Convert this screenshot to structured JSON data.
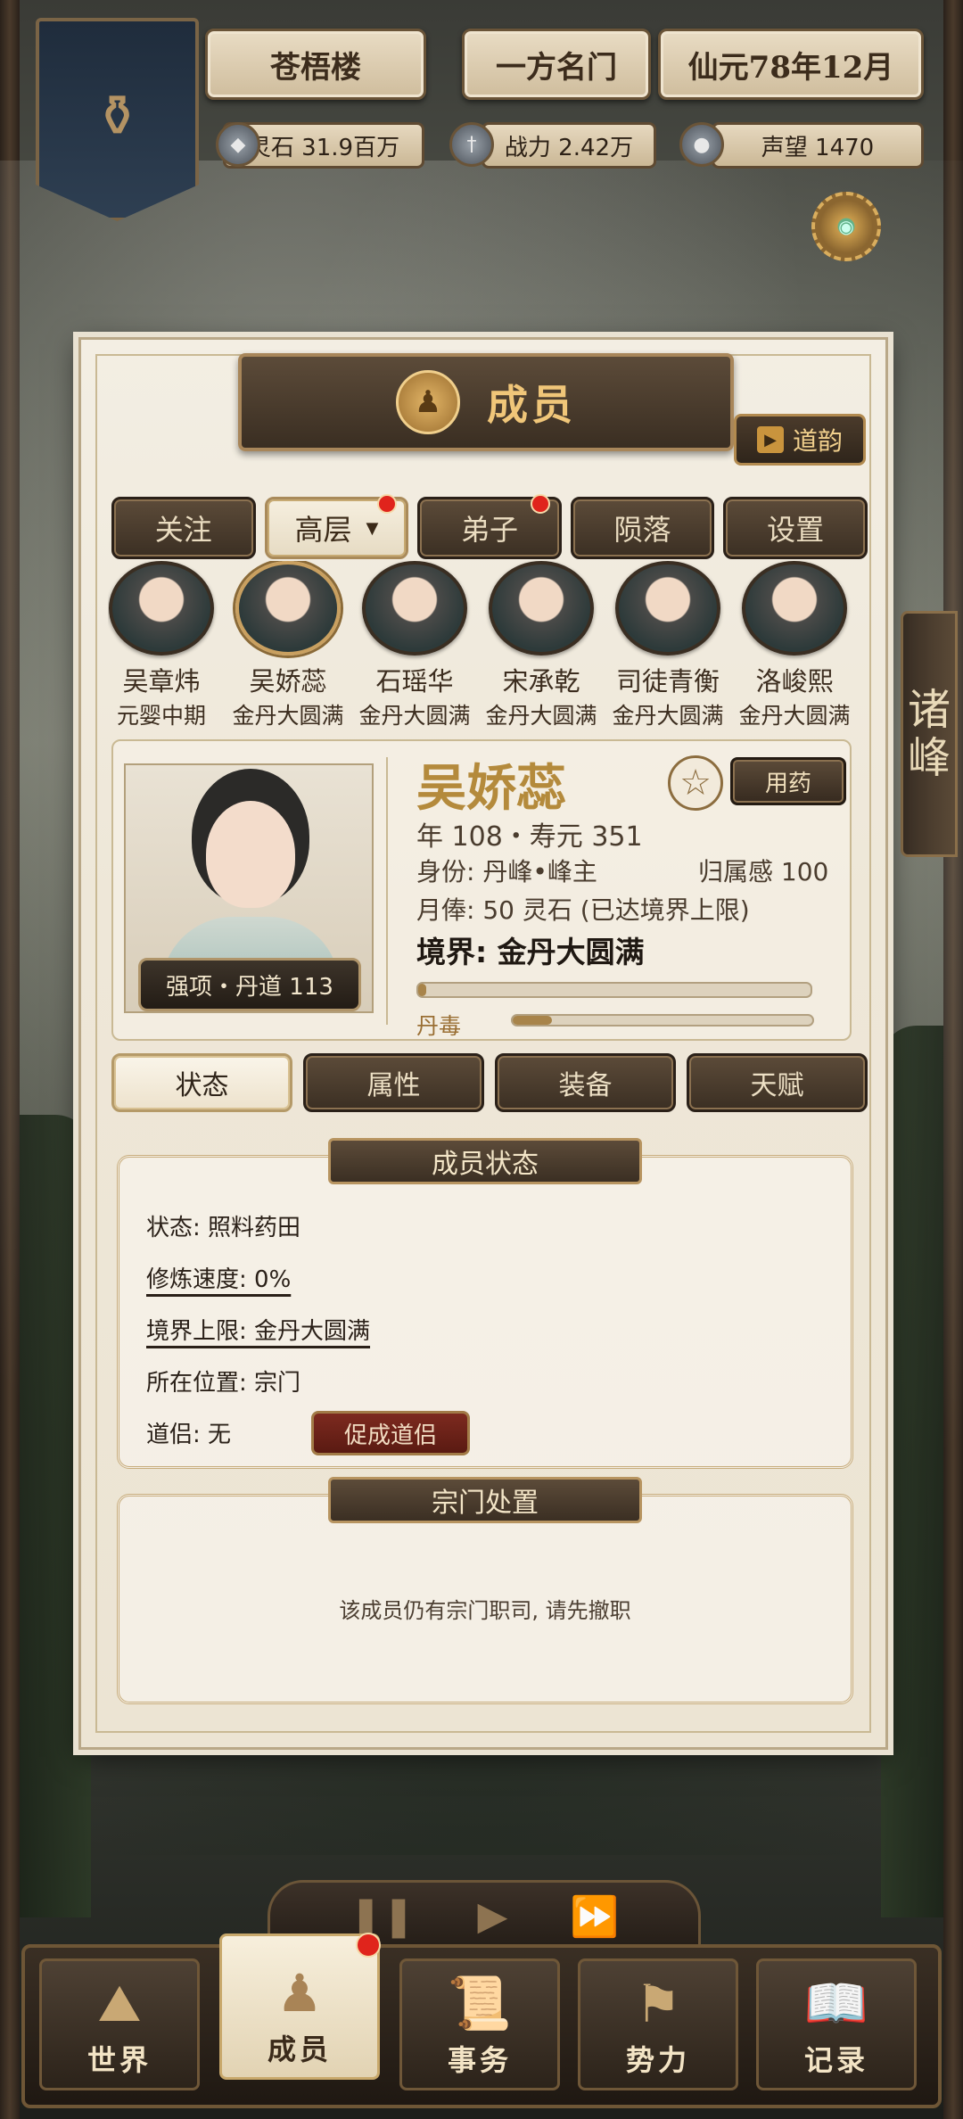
{
  "header": {
    "sect_name": "苍梧楼",
    "rank": "一方名门",
    "date": "仙元78年12月",
    "resources": [
      {
        "icon": "spirit-stone-icon",
        "label": "灵石 31.9百万"
      },
      {
        "icon": "sword-icon",
        "label": "战力 2.42万"
      },
      {
        "icon": "reputation-icon",
        "label": "声望 1470"
      }
    ]
  },
  "side_tab": {
    "label_1": "诸",
    "label_2": "峰"
  },
  "panel": {
    "title": "成员",
    "daoyun_label": "道韵",
    "filter_tabs": [
      {
        "label": "关注",
        "active": false,
        "badge": false
      },
      {
        "label": "高层",
        "active": true,
        "badge": true
      },
      {
        "label": "弟子",
        "active": false,
        "badge": true
      },
      {
        "label": "陨落",
        "active": false,
        "badge": false
      },
      {
        "label": "设置",
        "active": false,
        "badge": false
      }
    ],
    "members": [
      {
        "name": "吴章炜",
        "realm": "元婴中期"
      },
      {
        "name": "吴娇蕊",
        "realm": "金丹大圆满",
        "selected": true
      },
      {
        "name": "石瑶华",
        "realm": "金丹大圆满"
      },
      {
        "name": "宋承乾",
        "realm": "金丹大圆满"
      },
      {
        "name": "司徒青衡",
        "realm": "金丹大圆满"
      },
      {
        "name": "洛峻熙",
        "realm": "金丹大圆满"
      }
    ],
    "profile": {
      "name": "吴娇蕊",
      "strength": "强项・丹道 113",
      "use_medicine": "用药",
      "age_line": "年 108・寿元 351",
      "identity": "身份: 丹峰•峰主",
      "belonging": "归属感 100",
      "salary": "月俸: 50 灵石 (已达境界上限)",
      "realm": "境界: 金丹大圆满",
      "cultivation_progress": 0.02,
      "dan_poison_label": "丹毒",
      "dan_poison_progress": 0.13
    },
    "sub_tabs": [
      {
        "label": "状态",
        "active": true
      },
      {
        "label": "属性",
        "active": false
      },
      {
        "label": "装备",
        "active": false
      },
      {
        "label": "天赋",
        "active": false
      }
    ],
    "status_box": {
      "title": "成员状态",
      "state": "状态: 照料药田",
      "speed": "修炼速度: 0%",
      "limit": "境界上限: 金丹大圆满",
      "location": "所在位置: 宗门",
      "partner": "道侣: 无",
      "partner_button": "促成道侣"
    },
    "sect_box": {
      "title": "宗门处置",
      "notice": "该成员仍有宗门职司, 请先撤职"
    }
  },
  "speed_controls": {
    "pause": "❚❚",
    "play": "▶",
    "fast": "⏩"
  },
  "bottom_nav": [
    {
      "label": "世界",
      "icon": "world-icon",
      "active": false,
      "badge": false
    },
    {
      "label": "成员",
      "icon": "member-icon",
      "active": true,
      "badge": true
    },
    {
      "label": "事务",
      "icon": "scroll-icon",
      "active": false,
      "badge": false
    },
    {
      "label": "势力",
      "icon": "banner-icon",
      "active": false,
      "badge": false
    },
    {
      "label": "记录",
      "icon": "book-icon",
      "active": false,
      "badge": false
    }
  ]
}
